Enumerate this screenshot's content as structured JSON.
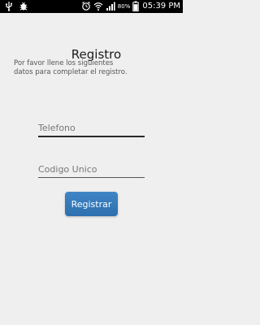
{
  "status_bar": {
    "battery_percent": "80%",
    "time": "05:39 PM",
    "icons": [
      "usb-icon",
      "bug-icon",
      "alarm-icon",
      "wifi-icon",
      "signal-icon",
      "battery-icon"
    ]
  },
  "main": {
    "title": "Registro",
    "subtitle_line1": "Por favor llene los siguientes",
    "subtitle_line2": "datos para completar el registro.",
    "phone_placeholder": "Telefono",
    "code_placeholder": "Codigo Unico",
    "register_label": "Registrar"
  },
  "colors": {
    "background": "#efefef",
    "button": "#3a7fc0",
    "status_bar": "#000000"
  }
}
